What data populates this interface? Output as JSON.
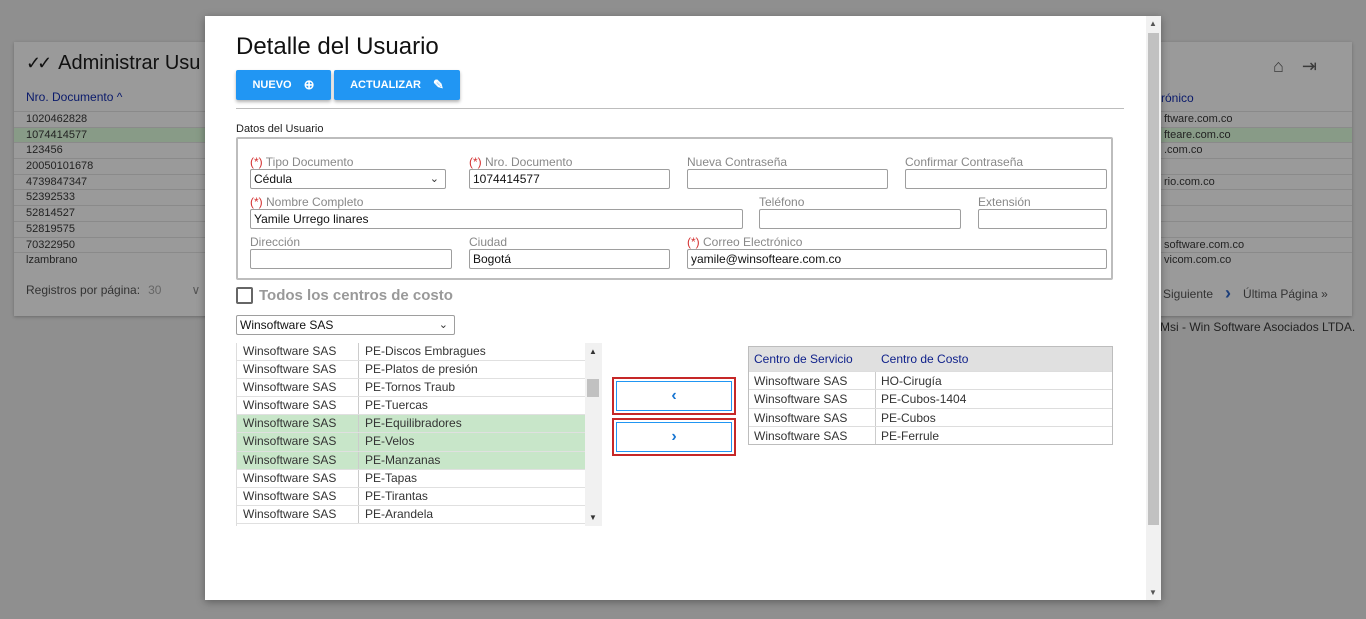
{
  "background": {
    "title": "Administrar Usu",
    "column_left": "Nro. Documento",
    "column_right": "rónico",
    "rows": [
      {
        "doc": "1020462828",
        "email": "ftware.com.co"
      },
      {
        "doc": "1074414577",
        "email": "fteare.com.co"
      },
      {
        "doc": "123456",
        "email": ".com.co"
      },
      {
        "doc": "20050101678",
        "email": ""
      },
      {
        "doc": "4739847347",
        "email": "rio.com.co"
      },
      {
        "doc": "52392533",
        "email": ""
      },
      {
        "doc": "52814527",
        "email": ""
      },
      {
        "doc": "52819575",
        "email": ""
      },
      {
        "doc": "70322950",
        "email": "software.com.co"
      },
      {
        "doc": "lzambrano",
        "email": "vicom.com.co"
      }
    ],
    "footer_label": "Registros por página:",
    "footer_value": "30",
    "next_label": "Siguiente",
    "last_label": "Última Página »",
    "copyright": "Msi - Win Software Asociados LTDA."
  },
  "modal": {
    "title": "Detalle del Usuario",
    "btn_new": "NUEVO",
    "btn_update": "ACTUALIZAR",
    "section_label": "Datos del Usuario",
    "req_mark": "(*)",
    "fields": {
      "tipo_documento": {
        "label": "Tipo Documento",
        "value": "Cédula"
      },
      "nro_documento": {
        "label": "Nro. Documento",
        "value": "1074414577"
      },
      "nueva_contrasena": {
        "label": "Nueva Contraseña",
        "value": ""
      },
      "confirmar_contrasena": {
        "label": "Confirmar Contraseña",
        "value": ""
      },
      "nombre_completo": {
        "label": "Nombre Completo",
        "value": "Yamile Urrego linares"
      },
      "telefono": {
        "label": "Teléfono",
        "value": ""
      },
      "extension": {
        "label": "Extensión",
        "value": ""
      },
      "direccion": {
        "label": "Dirección",
        "value": ""
      },
      "ciudad": {
        "label": "Ciudad",
        "value": "Bogotá"
      },
      "correo": {
        "label": "Correo Electrónico",
        "value": "yamile@winsofteare.com.co"
      }
    },
    "all_cost_centers_label": "Todos los centros de costo",
    "company_select": "Winsoftware SAS",
    "available": [
      {
        "company": "Winsoftware SAS",
        "center": "PE-Discos Embragues",
        "selected": false
      },
      {
        "company": "Winsoftware SAS",
        "center": "PE-Platos de presión",
        "selected": false
      },
      {
        "company": "Winsoftware SAS",
        "center": "PE-Tornos Traub",
        "selected": false
      },
      {
        "company": "Winsoftware SAS",
        "center": "PE-Tuercas",
        "selected": false
      },
      {
        "company": "Winsoftware SAS",
        "center": "PE-Equilibradores",
        "selected": true
      },
      {
        "company": "Winsoftware SAS",
        "center": "PE-Velos",
        "selected": true
      },
      {
        "company": "Winsoftware SAS",
        "center": "PE-Manzanas",
        "selected": true
      },
      {
        "company": "Winsoftware SAS",
        "center": "PE-Tapas",
        "selected": false
      },
      {
        "company": "Winsoftware SAS",
        "center": "PE-Tirantas",
        "selected": false
      },
      {
        "company": "Winsoftware SAS",
        "center": "PE-Arandela",
        "selected": false
      }
    ],
    "assigned_headers": {
      "service": "Centro de Servicio",
      "cost": "Centro de Costo"
    },
    "assigned": [
      {
        "service": "Winsoftware SAS",
        "cost": "HO-Cirugía"
      },
      {
        "service": "Winsoftware SAS",
        "cost": "PE-Cubos-1404"
      },
      {
        "service": "Winsoftware SAS",
        "cost": "PE-Cubos"
      },
      {
        "service": "Winsoftware SAS",
        "cost": "PE-Ferrule"
      }
    ],
    "move_left_icon": "chevron-left-icon",
    "move_right_icon": "chevron-right-icon"
  }
}
